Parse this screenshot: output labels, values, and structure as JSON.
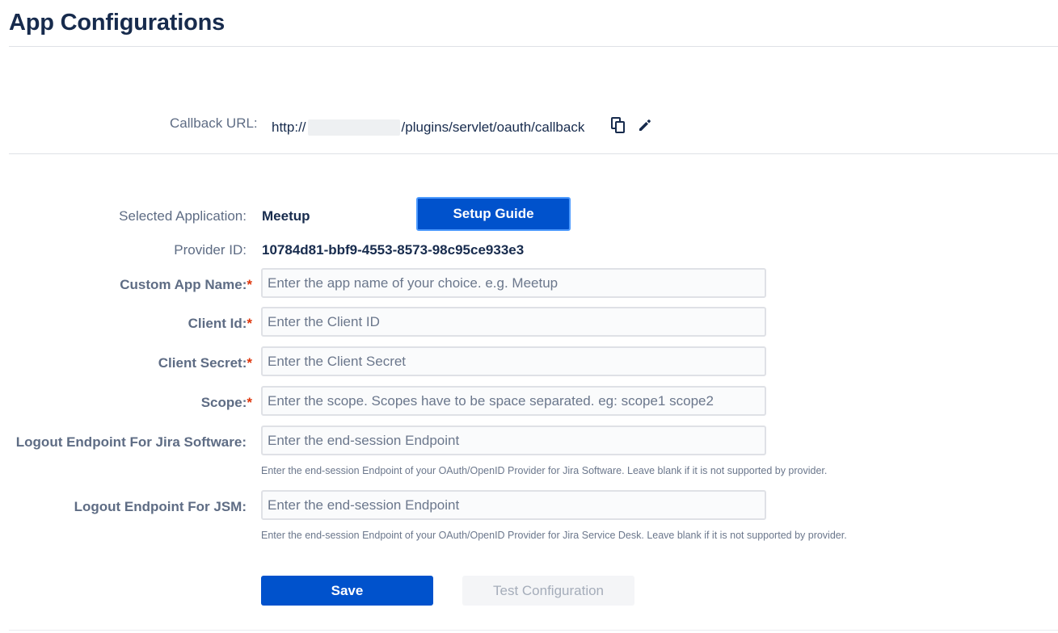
{
  "page": {
    "title": "App Configurations"
  },
  "callback": {
    "label": "Callback URL:",
    "url_prefix": "http://",
    "url_suffix": "/plugins/servlet/oauth/callback"
  },
  "app": {
    "selected_label": "Selected Application:",
    "selected_value": "Meetup",
    "setup_guide_label": "Setup Guide",
    "provider_label": "Provider ID:",
    "provider_value": "10784d81-bbf9-4553-8573-98c95ce933e3"
  },
  "form": {
    "custom_app_name": {
      "label": "Custom App Name:",
      "placeholder": "Enter the app name of your choice. e.g. Meetup",
      "value": ""
    },
    "client_id": {
      "label": "Client Id:",
      "placeholder": "Enter the Client ID",
      "value": ""
    },
    "client_secret": {
      "label": "Client Secret:",
      "placeholder": "Enter the Client Secret",
      "value": ""
    },
    "scope": {
      "label": "Scope:",
      "placeholder": "Enter the scope. Scopes have to be space separated. eg: scope1 scope2",
      "value": ""
    },
    "logout_jira": {
      "label": "Logout Endpoint For Jira Software:",
      "placeholder": "Enter the end-session Endpoint",
      "value": "",
      "help": "Enter the end-session Endpoint of your OAuth/OpenID Provider for Jira Software. Leave blank if it is not supported by provider."
    },
    "logout_jsm": {
      "label": "Logout Endpoint For JSM:",
      "placeholder": "Enter the end-session Endpoint",
      "value": "",
      "help": "Enter the end-session Endpoint of your OAuth/OpenID Provider for Jira Service Desk. Leave blank if it is not supported by provider."
    },
    "required_marker": "*"
  },
  "actions": {
    "save_label": "Save",
    "test_label": "Test Configuration"
  },
  "icons": {
    "copy": "copy-icon",
    "edit": "pencil-icon"
  },
  "colors": {
    "primary": "#0052cc",
    "required": "#de350b",
    "title": "#172b4d",
    "label": "#5e6c84"
  }
}
